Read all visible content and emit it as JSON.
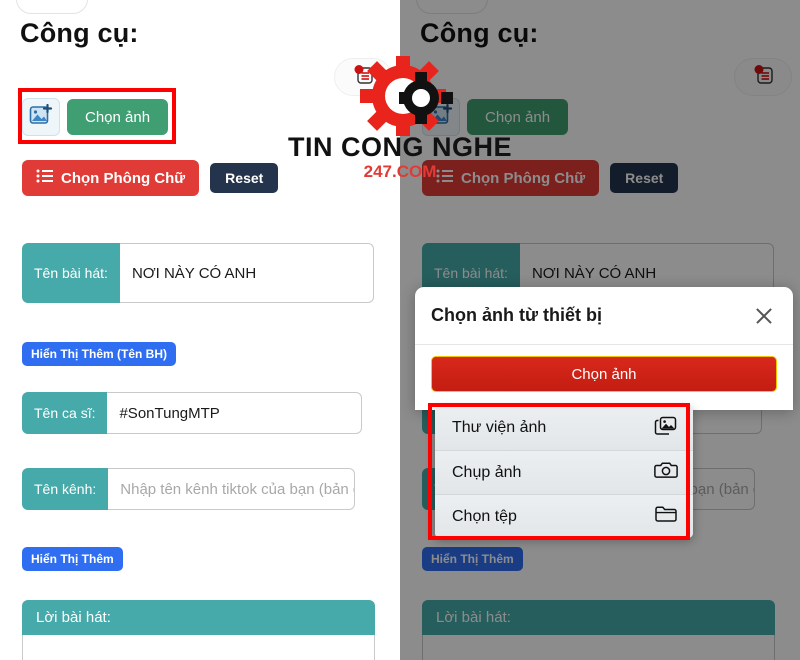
{
  "app": {
    "page_title": "Công cụ:"
  },
  "toolbar": {
    "pick_image_label": "Chọn ảnh",
    "pick_font_label": "Chọn Phông Chữ",
    "reset_label": "Reset",
    "image_icon": "add-photo-icon",
    "list_icon": "list-icon",
    "notification_icon": "notification-list-icon"
  },
  "fields": [
    {
      "label": "Tên bài hát:",
      "value": "NƠI NÀY CÓ ANH",
      "placeholder": "",
      "is_placeholder": false
    },
    {
      "label": "Tên ca sĩ:",
      "value": "#SonTungMTP",
      "placeholder": "",
      "is_placeholder": false
    },
    {
      "label": "Tên kênh:",
      "value": "Nhập tên kênh tiktok của bạn (bản qu",
      "placeholder": "Nhập tên kênh tiktok của bạn (bản quyền)",
      "is_placeholder": true
    }
  ],
  "expand_buttons": {
    "song_name": "Hiển Thị Thêm (Tên BH)",
    "channel": "Hiển Thị Thêm"
  },
  "lyrics": {
    "label": "Lời bài hát:",
    "value": ""
  },
  "modal": {
    "title": "Chọn ảnh từ thiết bị",
    "close_icon": "close-icon",
    "primary_button": "Chọn ảnh"
  },
  "sheet": {
    "items": [
      {
        "label": "Thư viện ảnh",
        "icon": "photo-library-icon"
      },
      {
        "label": "Chụp ảnh",
        "icon": "camera-icon"
      },
      {
        "label": "Chọn tệp",
        "icon": "folder-icon"
      }
    ]
  },
  "watermark": {
    "title": "TIN CONG NGHE",
    "subtitle": "247.COM",
    "logo_icon": "gear-logo-icon"
  },
  "colors": {
    "teal": "#45aaa9",
    "green": "#3f9e72",
    "red": "#e03b36",
    "dark_navy": "#24344d",
    "blue": "#2f6ef0",
    "modal_red": "#d9281c",
    "annotation": "#ff0000"
  }
}
